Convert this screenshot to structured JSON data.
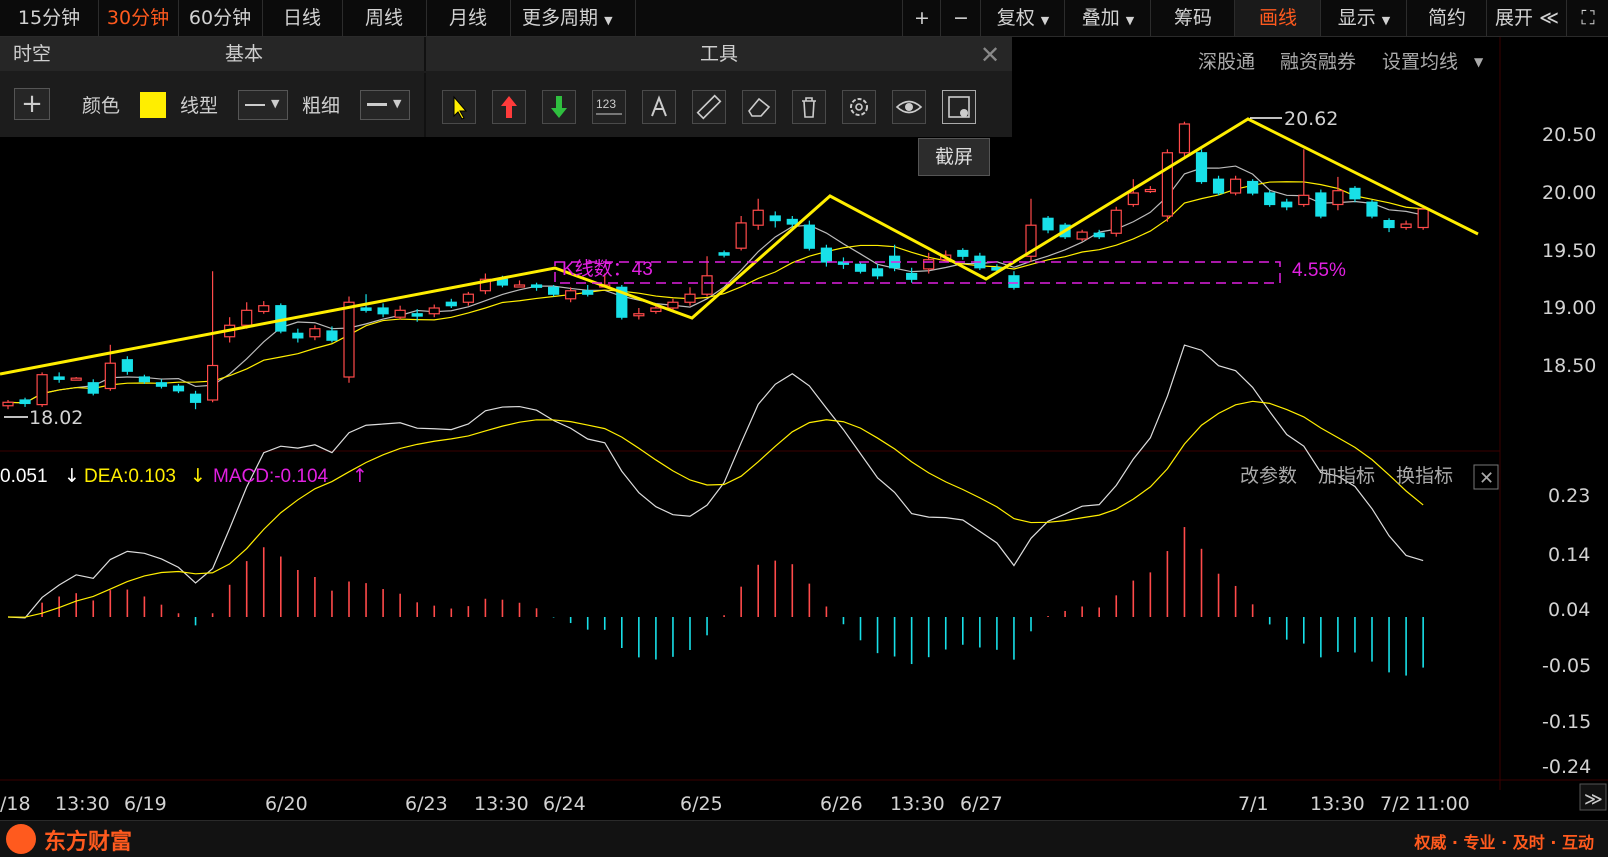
{
  "topbar": {
    "periods": [
      "15分钟",
      "30分钟",
      "60分钟",
      "日线",
      "周线",
      "月线",
      "更多周期"
    ],
    "active_period": "30分钟",
    "right_buttons": [
      "+",
      "−",
      "复权",
      "叠加",
      "筹码",
      "画线",
      "显示",
      "简约",
      "展开"
    ],
    "active_right": "画线"
  },
  "toolbox": {
    "left_partial_header": "时空",
    "header_basic": "基本",
    "header_tools": "工具",
    "color_label": "颜色",
    "color_value": "#ffee00",
    "line_type_label": "线型",
    "thickness_label": "粗细",
    "tools": [
      "select-arrow-icon",
      "up-arrow-icon",
      "down-arrow-icon",
      "number-123-icon",
      "text-a-icon",
      "ruler-icon",
      "eraser-icon",
      "trash-icon",
      "settings-icon",
      "eye-icon",
      "screenshot-icon"
    ],
    "tooltip": "截屏"
  },
  "main_links": [
    "深股通",
    "融资融券",
    "设置均线"
  ],
  "price_axis": [
    "20.50",
    "20.00",
    "19.50",
    "19.00",
    "18.50"
  ],
  "annotations": {
    "high": "20.62",
    "low": "18.02",
    "kline_count": "K线数：43",
    "pct": "4.55%"
  },
  "macd": {
    "dif": "0.051",
    "dea": "DEA:0.103",
    "macd": "MACD:-0.104",
    "buttons": [
      "改参数",
      "加指标",
      "换指标"
    ],
    "axis": [
      "0.23",
      "0.14",
      "0.04",
      "-0.05",
      "-0.15",
      "-0.24"
    ]
  },
  "dates": [
    "/18",
    "13:30",
    "6/19",
    "6/20",
    "6/23",
    "13:30",
    "6/24",
    "6/25",
    "6/26",
    "13:30",
    "6/27",
    "7/1",
    "13:30",
    "7/2",
    "11:00"
  ],
  "footer": {
    "brand": "东方财富",
    "slogan": "权威 · 专业 · 及时 · 互动"
  },
  "colors": {
    "up": "#ff4a4a",
    "down": "#18e0e8",
    "yellow": "#ffee00",
    "magenta": "#e020e0",
    "accent": "#ff5a1e"
  },
  "chart_data": {
    "type": "candlestick",
    "ylim": [
      18.0,
      20.7
    ],
    "candles": [
      [
        18.15,
        18.18,
        18.12,
        18.2
      ],
      [
        18.2,
        18.17,
        18.14,
        18.22
      ],
      [
        18.16,
        18.42,
        18.14,
        18.44
      ],
      [
        18.4,
        18.38,
        18.35,
        18.44
      ],
      [
        18.39,
        18.39,
        18.37,
        18.4
      ],
      [
        18.35,
        18.26,
        18.24,
        18.38
      ],
      [
        18.3,
        18.52,
        18.28,
        18.68
      ],
      [
        18.55,
        18.45,
        18.42,
        18.58
      ],
      [
        18.4,
        18.36,
        18.34,
        18.42
      ],
      [
        18.35,
        18.32,
        18.3,
        18.38
      ],
      [
        18.32,
        18.28,
        18.26,
        18.34
      ],
      [
        18.25,
        18.18,
        18.12,
        18.28
      ],
      [
        18.2,
        18.5,
        18.18,
        19.32
      ],
      [
        18.75,
        18.85,
        18.7,
        18.92
      ],
      [
        18.85,
        18.98,
        18.82,
        19.05
      ],
      [
        18.97,
        19.02,
        18.95,
        19.06
      ],
      [
        19.02,
        18.8,
        18.78,
        19.04
      ],
      [
        18.78,
        18.74,
        18.7,
        18.82
      ],
      [
        18.75,
        18.82,
        18.72,
        18.85
      ],
      [
        18.8,
        18.72,
        18.7,
        18.84
      ],
      [
        18.4,
        19.05,
        18.35,
        19.1
      ],
      [
        19.0,
        18.98,
        18.96,
        19.12
      ],
      [
        19.0,
        18.95,
        18.92,
        19.04
      ],
      [
        18.92,
        18.98,
        18.9,
        19.02
      ],
      [
        18.95,
        18.93,
        18.88,
        18.99
      ],
      [
        18.95,
        19.0,
        18.92,
        19.03
      ],
      [
        19.05,
        19.02,
        19.0,
        19.08
      ],
      [
        19.05,
        19.12,
        19.02,
        19.14
      ],
      [
        19.15,
        19.25,
        19.12,
        19.3
      ],
      [
        19.25,
        19.2,
        19.18,
        19.28
      ],
      [
        19.2,
        19.2,
        19.18,
        19.24
      ],
      [
        19.2,
        19.18,
        19.15,
        19.22
      ],
      [
        19.18,
        19.12,
        19.1,
        19.2
      ],
      [
        19.08,
        19.15,
        19.05,
        19.18
      ],
      [
        19.15,
        19.12,
        19.1,
        19.2
      ],
      [
        19.2,
        19.2,
        19.18,
        19.3
      ],
      [
        19.18,
        18.92,
        18.9,
        19.2
      ],
      [
        18.95,
        18.95,
        18.9,
        19.0
      ],
      [
        18.97,
        19.0,
        18.95,
        19.04
      ],
      [
        19.0,
        19.05,
        18.98,
        19.08
      ],
      [
        19.05,
        19.12,
        19.02,
        19.18
      ],
      [
        19.12,
        19.28,
        19.1,
        19.45
      ],
      [
        19.48,
        19.46,
        19.44,
        19.5
      ],
      [
        19.52,
        19.74,
        19.5,
        19.8
      ],
      [
        19.72,
        19.85,
        19.68,
        19.95
      ],
      [
        19.8,
        19.76,
        19.7,
        19.84
      ],
      [
        19.77,
        19.73,
        19.7,
        19.8
      ],
      [
        19.72,
        19.52,
        19.5,
        19.76
      ],
      [
        19.52,
        19.4,
        19.36,
        19.55
      ],
      [
        19.4,
        19.38,
        19.34,
        19.44
      ],
      [
        19.38,
        19.32,
        19.3,
        19.4
      ],
      [
        19.34,
        19.28,
        19.25,
        19.38
      ],
      [
        19.45,
        19.35,
        19.32,
        19.55
      ],
      [
        19.3,
        19.25,
        19.22,
        19.35
      ],
      [
        19.34,
        19.42,
        19.3,
        19.48
      ],
      [
        19.42,
        19.46,
        19.4,
        19.5
      ],
      [
        19.5,
        19.45,
        19.42,
        19.52
      ],
      [
        19.45,
        19.35,
        19.33,
        19.48
      ],
      [
        19.35,
        19.33,
        19.3,
        19.38
      ],
      [
        19.28,
        19.18,
        19.16,
        19.32
      ],
      [
        19.45,
        19.72,
        19.4,
        19.95
      ],
      [
        19.78,
        19.68,
        19.65,
        19.8
      ],
      [
        19.72,
        19.62,
        19.6,
        19.74
      ],
      [
        19.6,
        19.66,
        19.58,
        19.68
      ],
      [
        19.65,
        19.62,
        19.6,
        19.68
      ],
      [
        19.65,
        19.85,
        19.62,
        19.88
      ],
      [
        19.9,
        20.0,
        19.88,
        20.12
      ],
      [
        20.02,
        20.03,
        20.0,
        20.06
      ],
      [
        19.8,
        20.35,
        19.75,
        20.38
      ],
      [
        20.35,
        20.6,
        20.3,
        20.62
      ],
      [
        20.35,
        20.1,
        20.08,
        20.38
      ],
      [
        20.12,
        20.0,
        19.98,
        20.15
      ],
      [
        20.0,
        20.12,
        19.98,
        20.15
      ],
      [
        20.1,
        20.0,
        19.98,
        20.12
      ],
      [
        20.0,
        19.9,
        19.88,
        20.02
      ],
      [
        19.92,
        19.88,
        19.85,
        19.95
      ],
      [
        19.9,
        19.98,
        19.88,
        20.38
      ],
      [
        20.0,
        19.8,
        19.78,
        20.03
      ],
      [
        19.9,
        20.02,
        19.85,
        20.14
      ],
      [
        20.04,
        19.95,
        19.92,
        20.06
      ],
      [
        19.92,
        19.8,
        19.78,
        19.94
      ],
      [
        19.76,
        19.7,
        19.66,
        19.78
      ],
      [
        19.7,
        19.73,
        19.68,
        19.76
      ],
      [
        19.7,
        19.86,
        19.68,
        19.88
      ]
    ]
  }
}
